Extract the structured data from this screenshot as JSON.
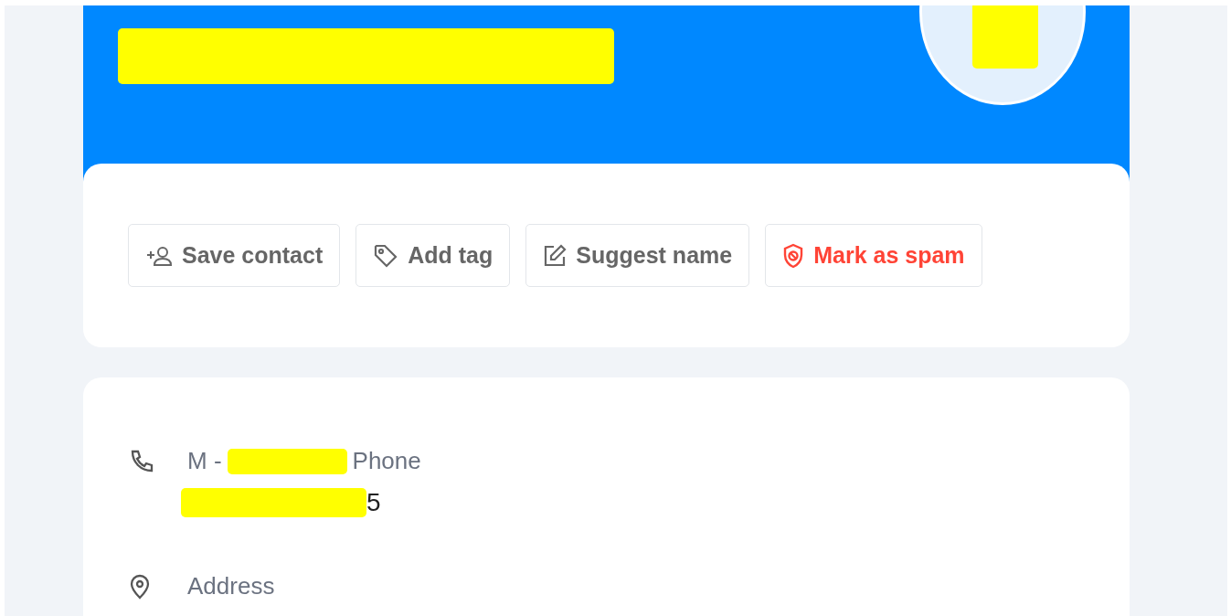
{
  "actions": [
    {
      "kind": "save",
      "label": "Save contact"
    },
    {
      "kind": "tag",
      "label": "Add tag"
    },
    {
      "kind": "suggest",
      "label": "Suggest name"
    },
    {
      "kind": "spam",
      "label": "Mark as spam"
    }
  ],
  "details": [
    {
      "kind": "phone",
      "label_prefix": "M -",
      "label_suffix": "Phone",
      "value": "5"
    },
    {
      "kind": "address",
      "label": "Address"
    }
  ]
}
